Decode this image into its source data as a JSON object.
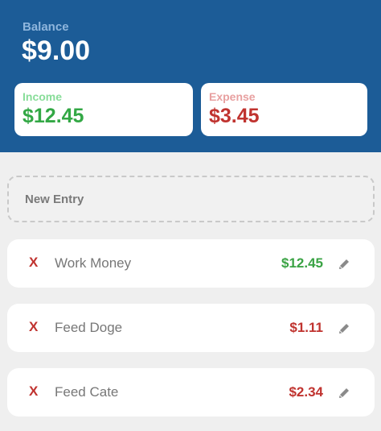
{
  "balance": {
    "label": "Balance",
    "value": "$9.00"
  },
  "income": {
    "label": "Income",
    "value": "$12.45"
  },
  "expense": {
    "label": "Expense",
    "value": "$3.45"
  },
  "new_entry": {
    "label": "New Entry"
  },
  "entries": [
    {
      "delete_label": "X",
      "name": "Work Money",
      "amount": "$12.45",
      "type": "income",
      "edit_icon": "pencil-icon"
    },
    {
      "delete_label": "X",
      "name": "Feed Doge",
      "amount": "$1.11",
      "type": "expense",
      "edit_icon": "pencil-icon"
    },
    {
      "delete_label": "X",
      "name": "Feed Cate",
      "amount": "$2.34",
      "type": "expense",
      "edit_icon": "pencil-icon"
    }
  ],
  "colors": {
    "header": "#1c5c97",
    "income": "#3aa344",
    "expense": "#c0332f",
    "background": "#efefef"
  }
}
